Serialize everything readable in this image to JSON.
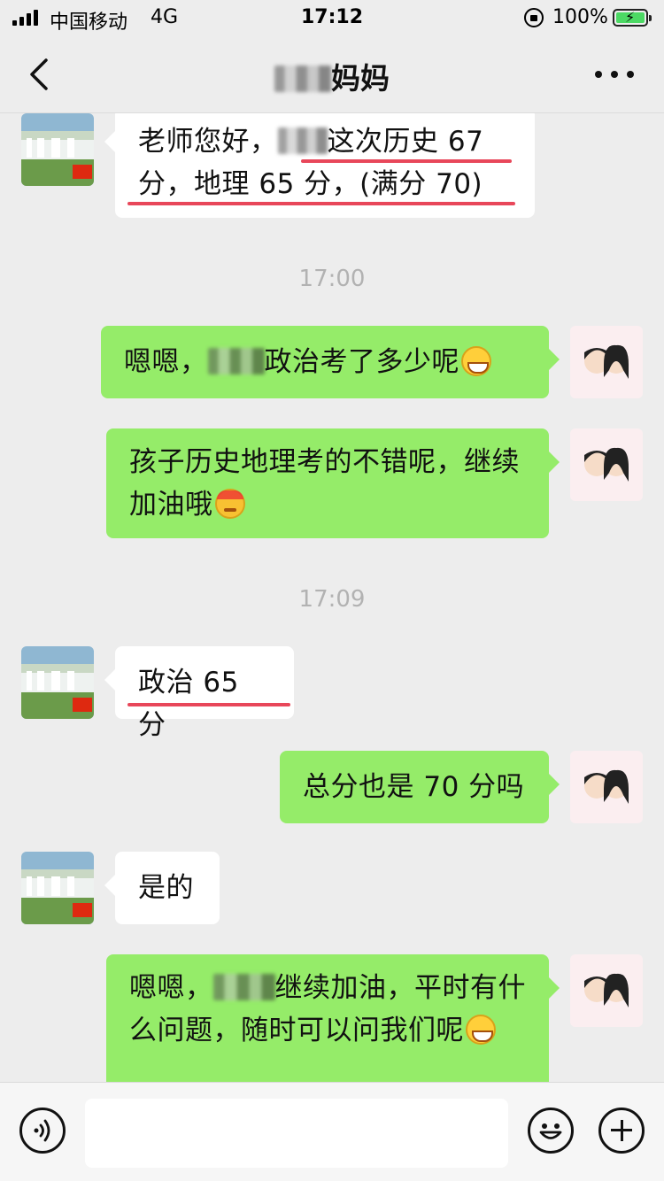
{
  "status_bar": {
    "carrier": "中国移动",
    "network": "4G",
    "time": "17:12",
    "battery_percent": "100%",
    "battery_color": "#4cd964"
  },
  "nav": {
    "back_icon": "chevron-left-icon",
    "title_suffix": "妈妈",
    "more_icon": "ellipsis-icon"
  },
  "messages": [
    {
      "from": "other",
      "text_a": "老师您好，",
      "text_b": "这次历史 67 分，地理 65 分，(满分 70)"
    },
    {
      "type": "time",
      "text": "17:00"
    },
    {
      "from": "me",
      "text_a": "嗯嗯，",
      "text_b": "政治考了多少呢",
      "emoji": "grin-emoji"
    },
    {
      "from": "me",
      "text": "孩子历史地理考的不错呢，继续加油哦",
      "emoji": "angry-emoji"
    },
    {
      "type": "time",
      "text": "17:09"
    },
    {
      "from": "other",
      "text": "政治 65 分"
    },
    {
      "from": "me",
      "text": "总分也是 70 分吗"
    },
    {
      "from": "other",
      "text": "是的"
    },
    {
      "from": "me",
      "text_a": "嗯嗯，",
      "text_b": "继续加油，平时有什么问题，随时可以问我们呢",
      "emoji": "grin-emoji"
    }
  ],
  "input_bar": {
    "voice_icon": "voice-icon",
    "emoji_icon": "smiley-icon",
    "plus_icon": "plus-icon",
    "text_value": ""
  },
  "colors": {
    "background": "#ededed",
    "outgoing_bubble": "#95ec69",
    "incoming_bubble": "#ffffff",
    "highlight_underline": "#e8475a"
  }
}
